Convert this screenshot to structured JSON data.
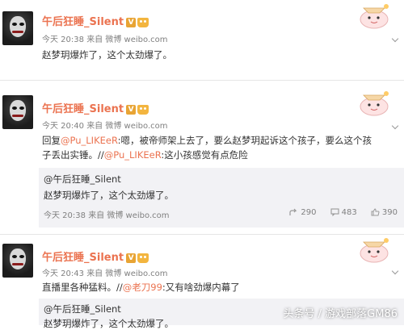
{
  "posts": [
    {
      "author": "午后狂睡_Silent",
      "time": "今天 20:38",
      "source_prefix": "来自",
      "source": "微博 weibo.com",
      "text": "赵梦玥爆炸了，这个太劲爆了。"
    },
    {
      "author": "午后狂睡_Silent",
      "time": "今天 20:40",
      "source_prefix": "来自",
      "source": "微博 weibo.com",
      "reply_prefix": "回复",
      "reply_mention": "@Pu_LIKEeR",
      "reply_text": ":嗯，被帝师架上去了，要么赵梦玥起诉这个孩子，要么这个孩",
      "reply_line2_a": "子丢出实锤。//",
      "reply_line2_mention": "@Pu_LIKEeR",
      "reply_line2_b": ":这小孩感觉有点危险",
      "repost": {
        "author": "@午后狂睡_Silent",
        "text": "赵梦玥爆炸了，这个太劲爆了。",
        "time": "今天 20:38",
        "source_prefix": "来自",
        "source": "微博 weibo.com",
        "reposts": "290",
        "comments": "483",
        "likes": "390"
      }
    },
    {
      "author": "午后狂睡_Silent",
      "time": "今天 20:43",
      "source_prefix": "来自",
      "source": "微博 weibo.com",
      "text_a": "直播里各种猛料。//",
      "mention": "@老刀99",
      "text_b": ":又有啥劲爆内幕了",
      "repost": {
        "author": "@午后狂睡_Silent",
        "text": "赵梦玥爆炸了，这个太劲爆了。"
      }
    }
  ],
  "badge_letter": "V",
  "watermark": "头条号 / 游戏部落GM86",
  "colors": {
    "name": "#eb7350",
    "meta": "#808080",
    "repost_bg": "#f2f2f5"
  }
}
